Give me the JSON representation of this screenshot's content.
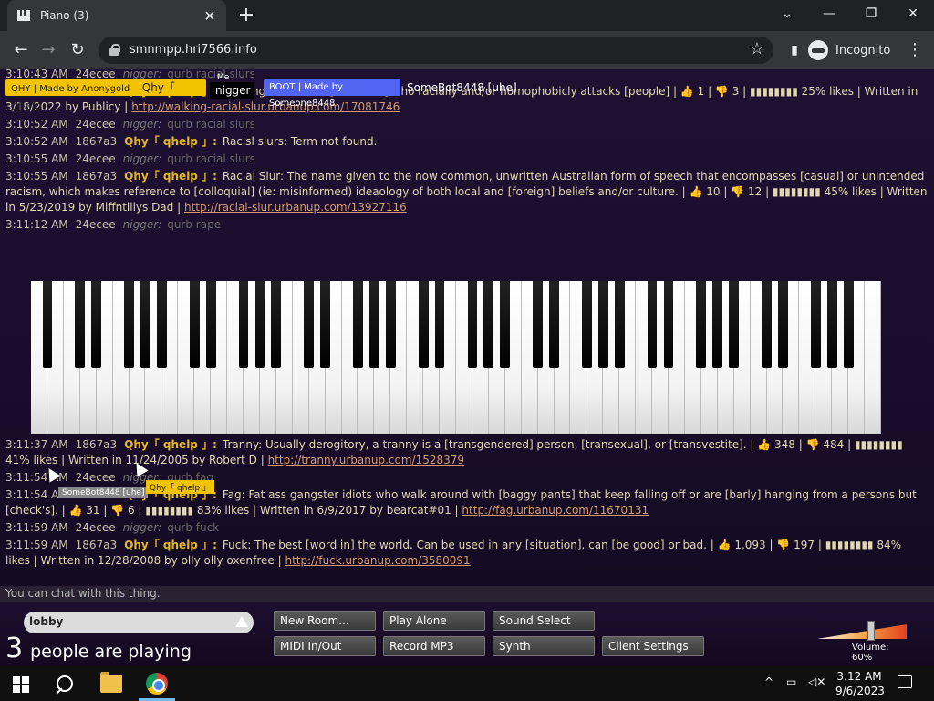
{
  "browser": {
    "tab_title": "Piano (3)",
    "tab_close": "✕",
    "new_tab": "+",
    "url": "smnmpp.hri7566.info",
    "profile_label": "Incognito",
    "win_min": "—",
    "win_restore": "❐",
    "win_close": "✕",
    "win_chevron": "⌄",
    "back": "←",
    "forward": "→",
    "reload": "↻",
    "star": "☆",
    "menu": "⋮"
  },
  "users": {
    "owner_label": "QHY | Made by Anonygold",
    "owner_name": "Qhy「 qhelp 」",
    "me_tag": "Me",
    "me_name": "nigger",
    "boot_label": "BOOT | Made by Someone8448",
    "bot_name": "SomeBot8448 [uhe]"
  },
  "chat": {
    "messages": [
      {
        "time": "3:10:43 AM",
        "id": "24ecee",
        "name": "nigger:",
        "text": "qurb racial slurs",
        "dim": true
      },
      {
        "time": "3:10:44 AM",
        "id": "1867a3",
        "name": "Qhy「 qhelp 」:",
        "text": "Walking racial slur: [someone] who racially and/or homophobicly attacks [people] | 👍 1 | 👎 3 | ▮▮▮▮▮▮▮▮ 25% likes | Written in 3/18/2022 by Publicy |",
        "link": "http://walking-racial-slur.urbanup.com/17081746",
        "dim": false
      },
      {
        "time": "3:10:52 AM",
        "id": "24ecee",
        "name": "nigger:",
        "text": "qurb racial slurs",
        "dim": true
      },
      {
        "time": "3:10:52 AM",
        "id": "1867a3",
        "name": "Qhy「 qhelp 」:",
        "text": "Racisl slurs: Term not found.",
        "dim": false
      },
      {
        "time": "3:10:55 AM",
        "id": "24ecee",
        "name": "nigger:",
        "text": "qurb racial slurs",
        "dim": true
      },
      {
        "time": "3:10:55 AM",
        "id": "1867a3",
        "name": "Qhy「 qhelp 」:",
        "text": "Racial Slur: The name given to the now common, unwritten Australian form of speech that encompasses [casual] or unintended racism, which makes reference to [colloquial] (ie: misinformed) ideaology of both local and [foreign] beliefs and/or culture. | 👍 10 | 👎 12 | ▮▮▮▮▮▮▮▮ 45% likes | Written in 5/23/2019 by Miffntillys Dad |",
        "link": "http://racial-slur.urbanup.com/13927116",
        "dim": false
      },
      {
        "time": "3:11:12 AM",
        "id": "24ecee",
        "name": "nigger:",
        "text": "qurb rape",
        "dim": true
      }
    ],
    "messages_after": [
      {
        "time": "3:11:37 AM",
        "id": "1867a3",
        "name": "Qhy「 qhelp 」:",
        "text": "Tranny: Usually derogitory, a tranny is a [transgendered] person, [transexual], or [transvestite]. | 👍 348 | 👎 484 | ▮▮▮▮▮▮▮▮ 41% likes | Written in 11/24/2005 by Robert D |",
        "link": "http://tranny.urbanup.com/1528379",
        "dim": false
      },
      {
        "time": "3:11:54 AM",
        "id": "24ecee",
        "name": "nigger:",
        "text": "qurb fag",
        "dim": true
      },
      {
        "time": "3:11:54 AM",
        "id": "1867a3",
        "name": "Qhy「 qhelp 」:",
        "text": "Fag: Fat ass gangster idiots who walk around with [baggy pants] that keep falling off or are [barly] hanging from a persons but [check's]. | 👍 31 | 👎 6 | ▮▮▮▮▮▮▮▮ 83% likes | Written in 6/9/2017 by bearcat#01 |",
        "link": "http://fag.urbanup.com/11670131",
        "dim": false
      },
      {
        "time": "3:11:59 AM",
        "id": "24ecee",
        "name": "nigger:",
        "text": "qurb fuck",
        "dim": true
      },
      {
        "time": "3:11:59 AM",
        "id": "1867a3",
        "name": "Qhy「 qhelp 」:",
        "text": "Fuck: The best [word in] the world. Can be used in any [situation]. can [be good] or bad. | 👍 1,093 | 👎 197 | ▮▮▮▮▮▮▮▮ 84% likes | Written in 12/28/2008 by olly olly oxenfree |",
        "link": "http://fuck.urbanup.com/3580091",
        "dim": false
      }
    ],
    "cursor_tip_1": "SomeBot8448 [uhe]",
    "cursor_tip_2": "Qhy「 qhelp 」",
    "input_placeholder": "You can chat with this thing."
  },
  "controls": {
    "room": "lobby",
    "people_count": "3",
    "people_label": "people are playing",
    "buttons": [
      "New Room...",
      "Play Alone",
      "Sound Select",
      "MIDI In/Out",
      "Record MP3",
      "Synth",
      "Client Settings"
    ],
    "volume_label": "Volume: 60%",
    "volume_level": 0.6
  },
  "taskbar": {
    "time": "3:12 AM",
    "date": "9/6/2023",
    "tray_chevron": "^"
  }
}
